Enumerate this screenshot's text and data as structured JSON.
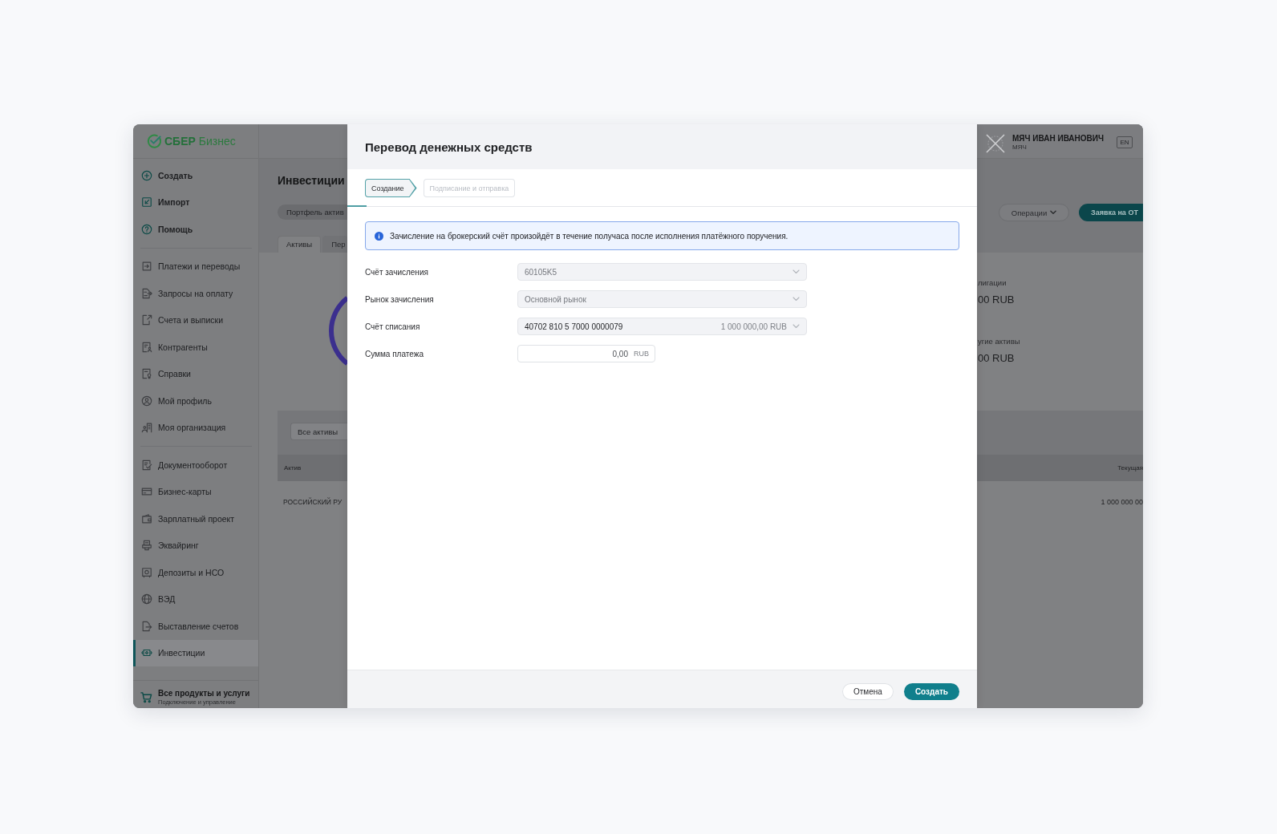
{
  "logo": "**СБЕР** Бизнес",
  "sidebar": {
    "groups": [
      {
        "kind": "actions",
        "items": [
          {
            "label": "Создать",
            "selected": false
          },
          {
            "label": "Импорт",
            "selected": false
          },
          {
            "label": "Помощь",
            "selected": false
          }
        ]
      },
      {
        "kind": "links",
        "items": [
          {
            "label": "Платежи и переводы",
            "selected": false
          },
          {
            "label": "Запросы на оплату",
            "selected": false
          },
          {
            "label": "Счета и выписки",
            "selected": false
          },
          {
            "label": "Контрагенты",
            "selected": false
          },
          {
            "label": "Справки",
            "selected": false
          },
          {
            "label": "Мой профиль",
            "selected": false
          },
          {
            "label": "Моя организация",
            "selected": false
          }
        ]
      },
      {
        "kind": "links",
        "items": [
          {
            "label": "Документооборот",
            "selected": false
          },
          {
            "label": "Бизнес-карты",
            "selected": false
          },
          {
            "label": "Зарплатный проект",
            "selected": false
          },
          {
            "label": "Эквайринг",
            "selected": false
          },
          {
            "label": "Депозиты и НСО",
            "selected": false
          },
          {
            "label": "ВЭД",
            "selected": false
          },
          {
            "label": "Выставление счетов",
            "selected": false
          },
          {
            "label": "Инвестиции",
            "selected": true
          }
        ]
      }
    ],
    "footer": {
      "title": "Все продукты и услуги",
      "subtitle": "Подключение и управление"
    }
  },
  "page": {
    "title": "Инвестиции",
    "portfolio_button": "Портфель актив",
    "tabs": [
      {
        "label": "Активы",
        "selected": true
      },
      {
        "label": "Пер",
        "selected": false
      }
    ],
    "filter": {
      "value": "Все активы"
    },
    "summary": [
      {
        "label": "лигации",
        "amount": "00 RUB"
      },
      {
        "label": "угие активы",
        "amount": "00 RUB"
      }
    ],
    "table": {
      "columns": [
        "Актив",
        "Текущая"
      ],
      "rows": [
        [
          "РОССИЙСКИЙ РУ",
          "1 000 000 00"
        ]
      ]
    }
  },
  "header": {
    "user_name": "МЯЧ ИВАН ИВАНОВИЧ",
    "organization": "МЯЧ",
    "language": "EN",
    "operations_button": "Операции",
    "request_button": "Заявка на ОТ"
  },
  "modal": {
    "title": "Перевод денежных средств",
    "steps": [
      {
        "label": "Создание",
        "selected": true
      },
      {
        "label": "Подписание и отправка",
        "selected": false
      }
    ],
    "progress": {
      "level": 0.03
    },
    "notice": "Зачисление на брокерский счёт произойдёт в течение получаса после исполнения платёжного поручения.",
    "fields": [
      {
        "kind": "select",
        "label": "Счёт зачисления",
        "value": "60105K5",
        "disabled": true
      },
      {
        "kind": "select",
        "label": "Рынок зачисления",
        "value": "Основной рынок",
        "disabled": true
      },
      {
        "kind": "select",
        "label": "Счёт списания",
        "value": "40702 810 5 7000 0000079",
        "balance": "1 000 000,00 RUB",
        "disabled": false
      },
      {
        "kind": "amount",
        "label": "Сумма платежа",
        "value": "0,00",
        "currency": "RUB"
      }
    ],
    "buttons": [
      {
        "kind": "secondary",
        "label": "Отмена"
      },
      {
        "kind": "primary",
        "label": "Создать"
      }
    ]
  }
}
